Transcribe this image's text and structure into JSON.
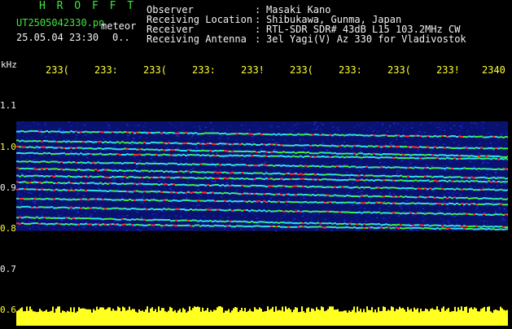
{
  "header": {
    "station_code": "H R O F F T",
    "filename": "UT2505042330.pn",
    "label_meteor": "meteor",
    "datetime": "25.05.04 23:30",
    "extra_mark": "0..",
    "fields": [
      {
        "key": "Observer",
        "sep": ":",
        "value": "Masaki Kano"
      },
      {
        "key": "Receiving Location",
        "sep": ":",
        "value": "Shibukawa, Gunma, Japan"
      },
      {
        "key": "Receiver",
        "sep": ":",
        "value": "RTL-SDR SDR# 43dB L15 103.2MHz CW"
      },
      {
        "key": "Receiving Antenna",
        "sep": ":",
        "value": "3el Yagi(V) Az 330 for Vladivostok"
      }
    ]
  },
  "axis": {
    "y_unit": "kHz",
    "y_ticks": [
      "1.1",
      "1.0",
      "0.9",
      "0.8",
      "0.7",
      "0.6"
    ],
    "x_ticks": [
      "233(",
      "233:",
      "233(",
      "233:",
      "233!",
      "233(",
      "233:",
      "233(",
      "233!",
      "2340"
    ]
  },
  "colors": {
    "background": "#000000",
    "noise_blue": "#1020c8",
    "signal_cyan": "#30e0e8",
    "signal_green": "#40f040",
    "signal_red": "#ff3030",
    "band_yellow": "#ffff20",
    "header_green": "#3ee83e"
  },
  "spectrogram": {
    "freq_top_khz": 1.03,
    "freq_bottom_khz": 0.765,
    "band_lines_khz": [
      1.008,
      0.985,
      0.97,
      0.955,
      0.935,
      0.918,
      0.9,
      0.885,
      0.868,
      0.845,
      0.825,
      0.8,
      0.785
    ]
  }
}
